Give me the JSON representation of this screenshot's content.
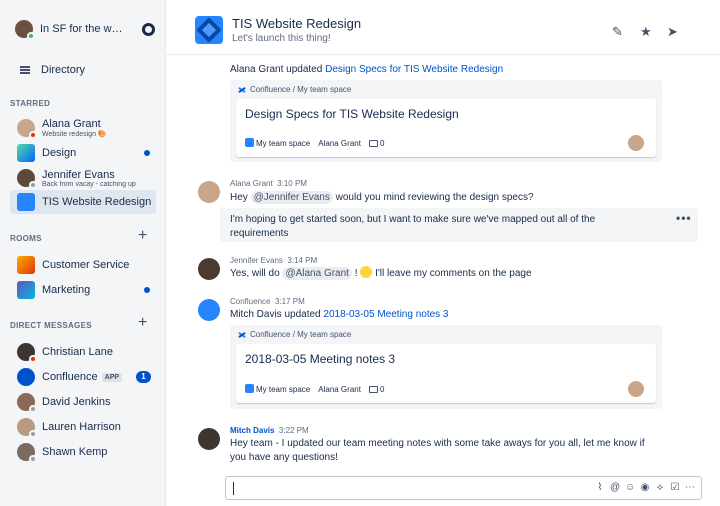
{
  "sidebar": {
    "status_label": "In SF for the week",
    "directory": "Directory",
    "starred_header": "STARRED",
    "rooms_header": "ROOMS",
    "dm_header": "DIRECT MESSAGES",
    "starred": [
      {
        "name": "Alana Grant",
        "sub": "Website redesign 🎨"
      },
      {
        "name": "Design"
      },
      {
        "name": "Jennifer Evans",
        "sub": "Back from vacay - catching up"
      },
      {
        "name": "TIS Website Redesign"
      }
    ],
    "rooms": [
      {
        "name": "Customer Service"
      },
      {
        "name": "Marketing"
      }
    ],
    "dms": [
      {
        "name": "Christian Lane"
      },
      {
        "name": "Confluence",
        "tag": "APP",
        "badge": "1"
      },
      {
        "name": "David Jenkins"
      },
      {
        "name": "Lauren Harrison"
      },
      {
        "name": "Shawn Kemp"
      }
    ]
  },
  "header": {
    "title": "TIS Website Redesign",
    "topic": "Let's launch this thing!"
  },
  "messages": {
    "m0": {
      "actor": "Alana Grant",
      "verb": " updated ",
      "link": "Design Specs for TIS Website Redesign"
    },
    "card1": {
      "source": "Confluence / My team space",
      "title": "Design Specs for TIS Website Redesign",
      "space": "My team space",
      "author": "Alana Grant",
      "comments": "0"
    },
    "m1": {
      "name": "Alana Grant",
      "time": "3:10 PM",
      "pre": "Hey ",
      "mention": "@Jennifer Evans",
      "post": " would you mind reviewing the design specs?"
    },
    "m1b": {
      "text": "I'm hoping to get started soon, but I want to make sure we've mapped out all of the requirements"
    },
    "m1b_more": "•••",
    "m2": {
      "name": "Jennifer Evans",
      "time": "3:14 PM",
      "pre": "Yes, will do ",
      "mention": "@Alana Grant",
      "mid": " ! ",
      "post": " I'll leave my comments on the page"
    },
    "m3": {
      "name": "Confluence",
      "time": "3:17 PM",
      "actor": "Mitch Davis",
      "verb": " updated ",
      "link": "2018-03-05 Meeting notes 3"
    },
    "card2": {
      "source": "Confluence / My team space",
      "title": "2018-03-05 Meeting notes 3",
      "space": "My team space",
      "author": "Alana Grant",
      "comments": "0"
    },
    "m4": {
      "name": "Mitch Davis",
      "time": "3:22 PM",
      "text": "Hey team - I updated our team meeting notes with some take aways for you all, let me know if you have any questions!"
    }
  },
  "colors": {
    "accent": "#0052cc",
    "sidebar_bg": "#f4f5f7",
    "online": "#36b37e",
    "busy": "#de350b"
  }
}
